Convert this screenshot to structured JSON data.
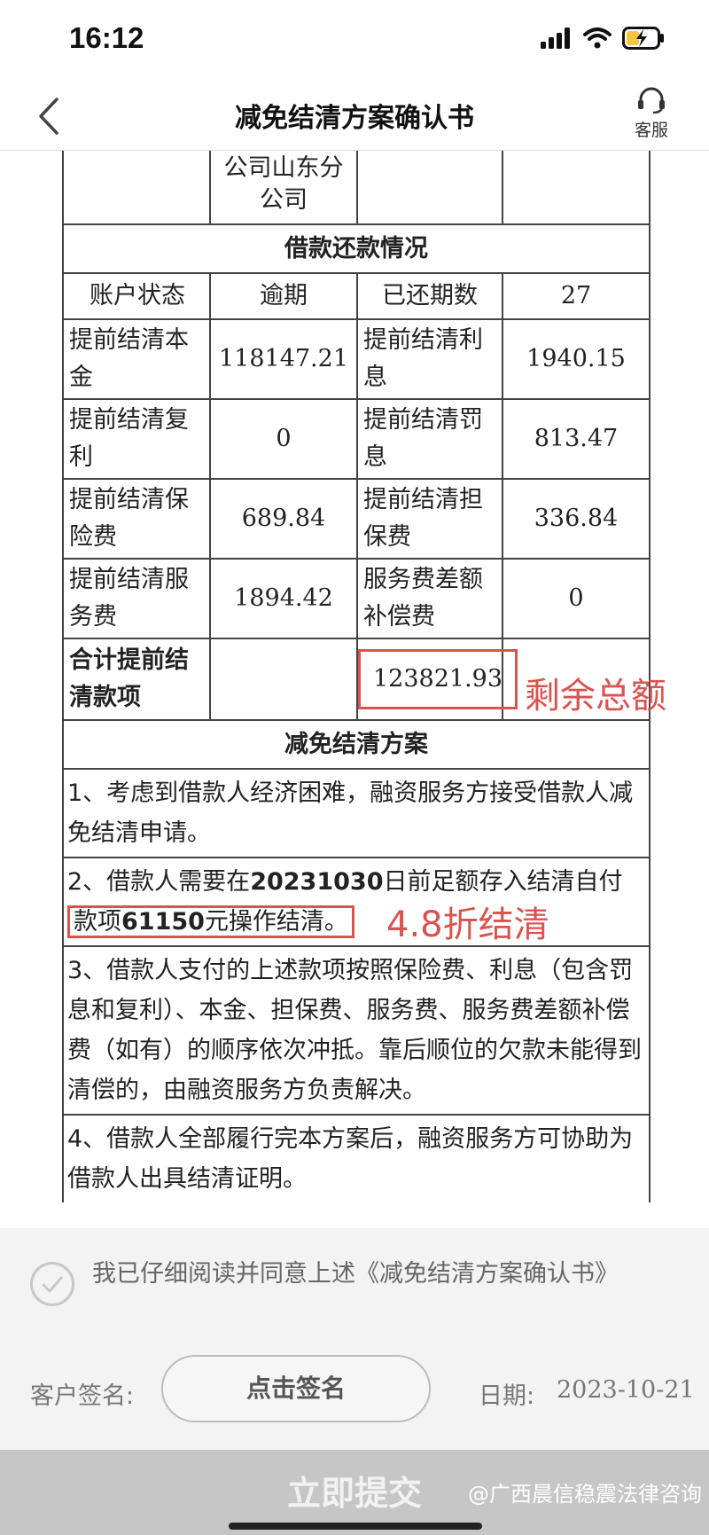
{
  "status_bar": {
    "time": "16:12"
  },
  "nav": {
    "title": "减免结清方案确认书",
    "service_label": "客服"
  },
  "table": {
    "top_partial": {
      "col2": "公司山东分\n公司"
    },
    "section1": "借款还款情况",
    "rows": [
      {
        "l1": "账户状态",
        "v1": "逾期",
        "l2": "已还期数",
        "v2": "27"
      },
      {
        "l1": "提前结清本金",
        "v1": "118147.21",
        "l2": "提前结清利息",
        "v2": "1940.15"
      },
      {
        "l1": "提前结清复利",
        "v1": "0",
        "l2": "提前结清罚息",
        "v2": "813.47"
      },
      {
        "l1": "提前结清保险费",
        "v1": "689.84",
        "l2": "提前结清担保费",
        "v2": "336.84"
      },
      {
        "l1": "提前结清服务费",
        "v1": "1894.42",
        "l2": "服务费差额补偿费",
        "v2": "0"
      }
    ],
    "total_label": "合计提前结清款项",
    "total_value": "123821.93",
    "section2": "减免结清方案",
    "para1": "1、考虑到借款人经济困难，融资服务方接受借款人减免结清申请。",
    "para2_a": "2、借款人需要在",
    "para2_date": "20231030",
    "para2_b": "日前足额存入结清自付",
    "para2_c": "款项",
    "para2_amount": "61150",
    "para2_d": "元操作结清。",
    "para3": "3、借款人支付的上述款项按照保险费、利息（包含罚息和复利）、本金、担保费、服务费、服务费差额补偿费（如有）的顺序依次冲抵。靠后顺位的欠款未能得到清偿的，由融资服务方负责解决。",
    "para4": "4、借款人全部履行完本方案后，融资服务方可协助为借款人出具结清证明。"
  },
  "annotations": {
    "total": "剩余总额",
    "discount": "4.8折结清"
  },
  "agreement": {
    "text": "我已仔细阅读并同意上述《减免结清方案确认书》",
    "signature_label": "客户签名:",
    "sign_button": "点击签名",
    "date_label": "日期:",
    "date_value": "2023-10-21"
  },
  "submit": {
    "label": "立即提交"
  },
  "watermark": "@广西晨信稳震法律咨询",
  "colors": {
    "annotation_red": "#d9534f",
    "submit_bg": "#c6c6c6",
    "panel_bg": "#f3f3f3"
  }
}
